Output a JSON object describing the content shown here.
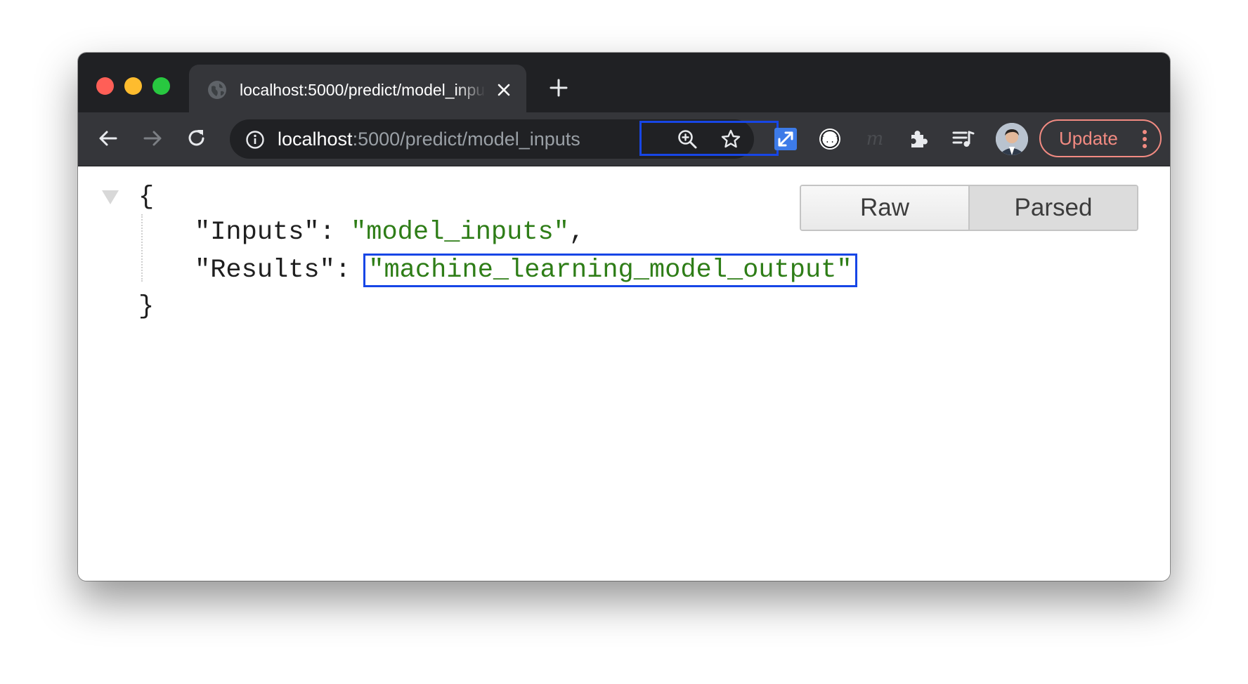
{
  "browser": {
    "tab": {
      "title": "localhost:5000/predict/model_inputs"
    },
    "address_bar": {
      "host": "localhost",
      "rest": ":5000/predict/model_inputs"
    },
    "update_button": {
      "label": "Update"
    },
    "colors": {
      "frame": "#202124",
      "toolbar": "#35363a",
      "update_accent": "#f28b82",
      "highlight_box": "#1746e6"
    }
  },
  "viewer": {
    "toggle": {
      "raw_label": "Raw",
      "parsed_label": "Parsed",
      "selected": "Parsed"
    },
    "json": {
      "open_brace": "{",
      "close_brace": "}",
      "entries": [
        {
          "key": "\"Inputs\"",
          "colon": ": ",
          "value": "\"model_inputs\"",
          "comma": ","
        },
        {
          "key": "\"Results\"",
          "colon": ": ",
          "value": "\"machine_learning_model_output\"",
          "comma": ""
        }
      ]
    },
    "colors": {
      "string_value": "#2e7d17",
      "key_text": "#1f1f1f"
    }
  }
}
